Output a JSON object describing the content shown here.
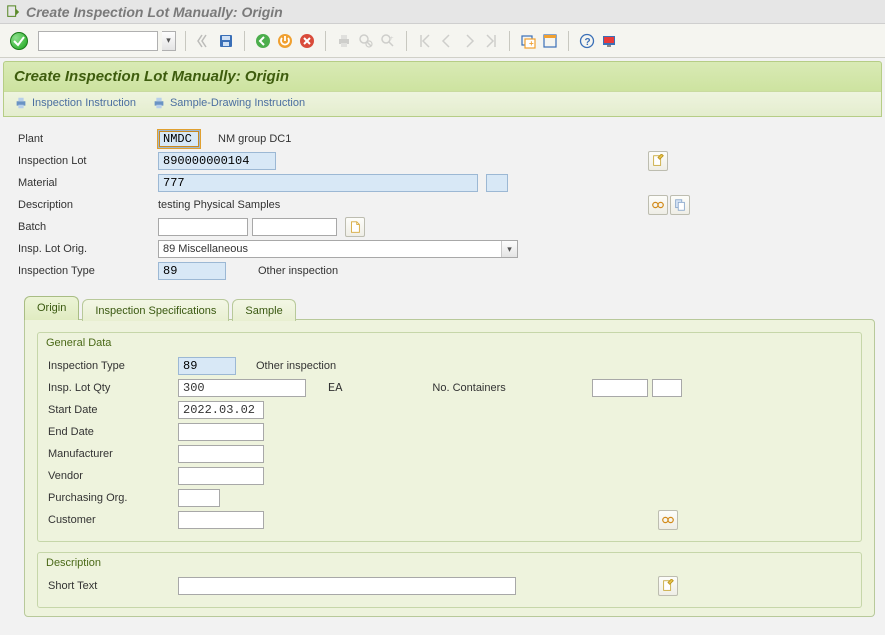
{
  "window": {
    "title": "Create Inspection Lot Manually: Origin"
  },
  "header": {
    "title": "Create Inspection Lot Manually: Origin",
    "actions": {
      "inspection_instruction": "Inspection Instruction",
      "sample_drawing_instruction": "Sample-Drawing Instruction"
    }
  },
  "form": {
    "plant": {
      "label": "Plant",
      "value": "NMDC",
      "text": "NM group DC1"
    },
    "inspection_lot": {
      "label": "Inspection Lot",
      "value": "890000000104"
    },
    "material": {
      "label": "Material",
      "value": "777"
    },
    "description": {
      "label": "Description",
      "value": "testing Physical Samples"
    },
    "batch": {
      "label": "Batch",
      "value": ""
    },
    "insp_lot_orig": {
      "label": "Insp. Lot Orig.",
      "value": "89 Miscellaneous"
    },
    "inspection_type": {
      "label": "Inspection Type",
      "value": "89",
      "text": "Other inspection"
    }
  },
  "tabs": {
    "origin": "Origin",
    "inspection_specifications": "Inspection Specifications",
    "sample": "Sample"
  },
  "origin_tab": {
    "general_data": {
      "title": "General Data",
      "inspection_type": {
        "label": "Inspection Type",
        "value": "89",
        "text": "Other inspection"
      },
      "insp_lot_qty": {
        "label": "Insp. Lot Qty",
        "value": "300",
        "uom": "EA"
      },
      "no_containers": {
        "label": "No. Containers",
        "value": "",
        "value2": ""
      },
      "start_date": {
        "label": "Start Date",
        "value": "2022.03.02"
      },
      "end_date": {
        "label": "End Date",
        "value": ""
      },
      "manufacturer": {
        "label": "Manufacturer",
        "value": ""
      },
      "vendor": {
        "label": "Vendor",
        "value": ""
      },
      "purchasing_org": {
        "label": "Purchasing Org.",
        "value": ""
      },
      "customer": {
        "label": "Customer",
        "value": ""
      }
    },
    "description": {
      "title": "Description",
      "short_text": {
        "label": "Short Text",
        "value": ""
      }
    }
  }
}
